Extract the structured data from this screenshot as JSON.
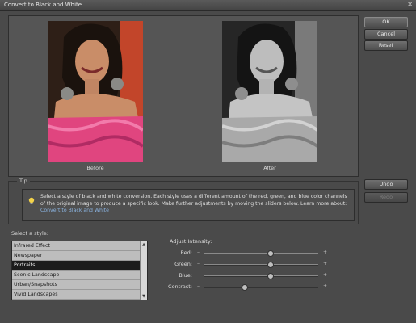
{
  "window": {
    "title": "Convert to Black and White",
    "close_glyph": "✕"
  },
  "buttons": {
    "ok": "OK",
    "cancel": "Cancel",
    "reset": "Reset",
    "undo": "Undo",
    "redo": "Redo"
  },
  "preview": {
    "before_label": "Before",
    "after_label": "After"
  },
  "tip": {
    "legend": "Tip",
    "icon": "lightbulb-icon",
    "text": "Select a style of black and white conversion. Each style uses a different amount of the red, green, and blue color channels of the original image to produce a specific look. Make further adjustments by moving the sliders below. Learn more about:",
    "link": "Convert to Black and White"
  },
  "styles": {
    "label": "Select a style:",
    "items": [
      "Infrared Effect",
      "Newspaper",
      "Portraits",
      "Scenic Landscape",
      "Urban/Snapshots",
      "Vivid Landscapes"
    ],
    "selected": "Portraits"
  },
  "intensity": {
    "label": "Adjust Intensity:",
    "sliders": [
      {
        "label": "Red:",
        "value": 0.58
      },
      {
        "label": "Green:",
        "value": 0.58
      },
      {
        "label": "Blue:",
        "value": 0.58
      },
      {
        "label": "Contrast:",
        "value": 0.35
      }
    ],
    "minus": "–",
    "plus": "+"
  }
}
